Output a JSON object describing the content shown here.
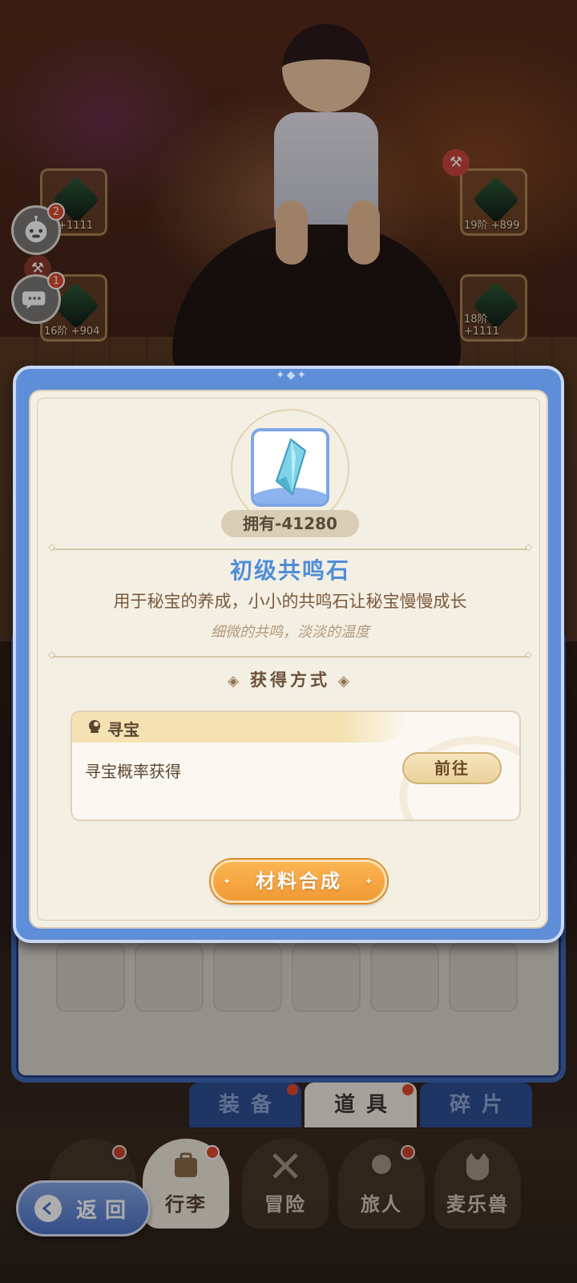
{
  "side_buttons": {
    "pet_badge": "2",
    "chat_badge": "1"
  },
  "equipment": {
    "slot_top_left_level": "阶 +1111",
    "slot_bottom_left_level": "16阶 +904",
    "slot_top_right_level": "19阶 +899",
    "slot_bottom_right_level": "18阶 +1111"
  },
  "item": {
    "owned": "拥有-41280",
    "name": "初级共鸣石",
    "description": "用于秘宝的养成，小小的共鸣石让秘宝慢慢成长",
    "flavor": "细微的共鸣，淡淡的温度",
    "acquire_title": "获得方式",
    "source_name": "寻宝",
    "source_text": "寻宝概率获得",
    "goto_label": "前往",
    "craft_label": "材料合成"
  },
  "bag_tabs": [
    {
      "label": "装备"
    },
    {
      "label": "道具"
    },
    {
      "label": "碎片"
    }
  ],
  "nav": {
    "back_label": "返回",
    "items": [
      {
        "label": "行李"
      },
      {
        "label": "冒险"
      },
      {
        "label": "旅人"
      },
      {
        "label": "麦乐兽"
      }
    ]
  },
  "colors": {
    "modal_frame": "#5f8ed9",
    "item_name": "#4f8ed8",
    "craft_button": "#f19a36",
    "badge": "#e2492f"
  }
}
